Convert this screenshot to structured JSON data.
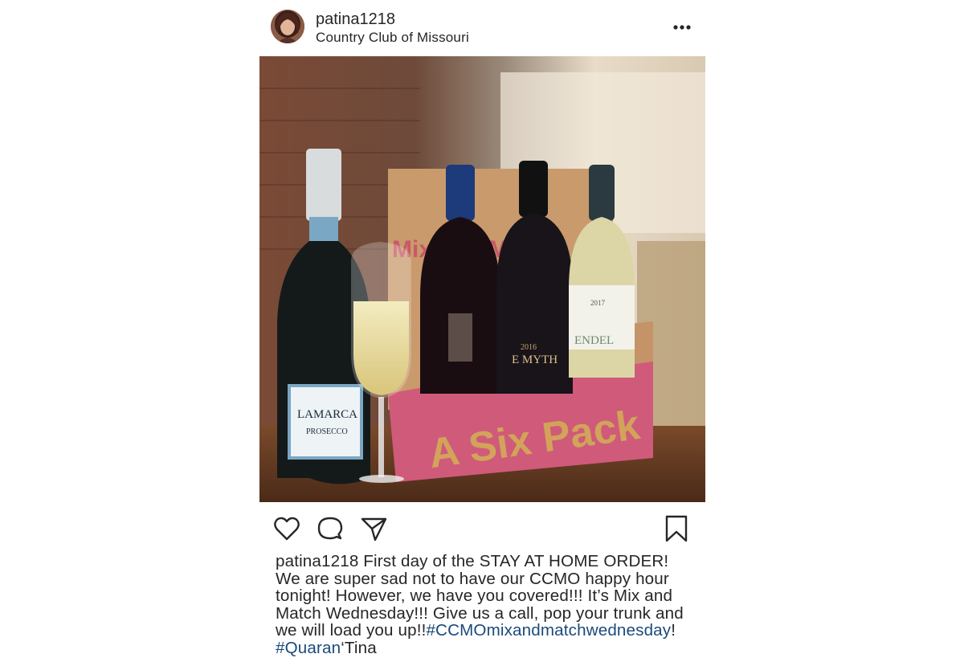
{
  "post": {
    "username": "patina1218",
    "location": "Country Club of Missouri",
    "more_icon": "more-horizontal-icon",
    "image": {
      "box_text_1": "A Six Pack",
      "box_text_2": "Mix and Match",
      "bottle_label_lamarca": "LAMARCA",
      "bottle_label_prosecco": "PROSECCO",
      "bottle_label_myth": "E MYTH",
      "bottle_label_year_myth": "2016",
      "bottle_label_year_white": "2017",
      "bottle_label_white": "ENDEL"
    },
    "actions": {
      "like_icon": "heart-icon",
      "comment_icon": "comment-icon",
      "share_icon": "send-icon",
      "save_icon": "bookmark-icon"
    },
    "caption": {
      "username": "patina1218",
      "text": " First day of the STAY AT HOME ORDER! We are super sad not to have our CCMO happy hour tonight! However, we have you covered!!! It’s Mix and Match Wednesday!!! Give us a call, pop your trunk and we will load you up!!",
      "hashtag_1": "#CCMOmixandmatchwednesday",
      "after_tag_1": "!",
      "hashtag_2": "#Quaran",
      "after_tag_2": "‘Tina"
    }
  }
}
